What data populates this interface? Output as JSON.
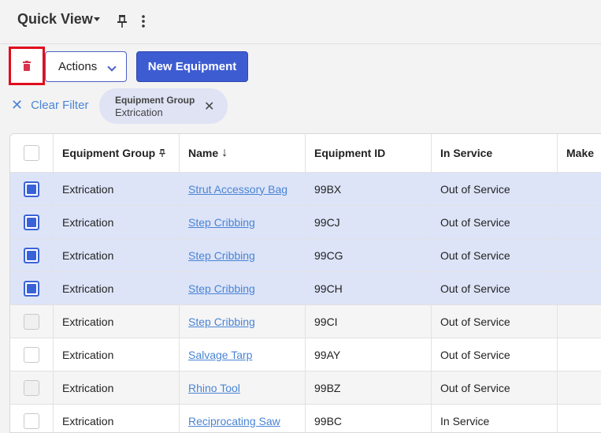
{
  "header": {
    "title": "Quick View"
  },
  "toolbar": {
    "actions_label": "Actions",
    "new_label": "New Equipment"
  },
  "filter": {
    "clear_label": "Clear Filter",
    "chip_key": "Equipment Group",
    "chip_value": "Extrication"
  },
  "table": {
    "columns": [
      "Equipment Group",
      "Name",
      "Equipment ID",
      "In Service",
      "Make"
    ],
    "sort_indicator": "↓",
    "rows": [
      {
        "group": "Extrication",
        "name": "Strut Accessory Bag",
        "id": "99BX",
        "status": "Out of Service",
        "make": "",
        "selected": true
      },
      {
        "group": "Extrication",
        "name": "Step Cribbing",
        "id": "99CJ",
        "status": "Out of Service",
        "make": "",
        "selected": true
      },
      {
        "group": "Extrication",
        "name": "Step Cribbing",
        "id": "99CG",
        "status": "Out of Service",
        "make": "",
        "selected": true
      },
      {
        "group": "Extrication",
        "name": "Step Cribbing",
        "id": "99CH",
        "status": "Out of Service",
        "make": "",
        "selected": true
      },
      {
        "group": "Extrication",
        "name": "Step Cribbing",
        "id": "99CI",
        "status": "Out of Service",
        "make": "",
        "selected": false
      },
      {
        "group": "Extrication",
        "name": "Salvage Tarp",
        "id": "99AY",
        "status": "Out of Service",
        "make": "",
        "selected": false
      },
      {
        "group": "Extrication",
        "name": "Rhino Tool",
        "id": "99BZ",
        "status": "Out of Service",
        "make": "",
        "selected": false
      },
      {
        "group": "Extrication",
        "name": "Reciprocating Saw",
        "id": "99BC",
        "status": "In Service",
        "make": "",
        "selected": false
      }
    ]
  },
  "colors": {
    "accent": "#3e5cd2",
    "selected_row": "#dde4f8",
    "delete_highlight": "#e00d1c",
    "trash": "#d8334a"
  },
  "icons": [
    "caret-down-icon",
    "pin-icon",
    "kebab-icon",
    "trash-icon",
    "chevron-down-icon",
    "close-icon",
    "sort-down-icon"
  ]
}
